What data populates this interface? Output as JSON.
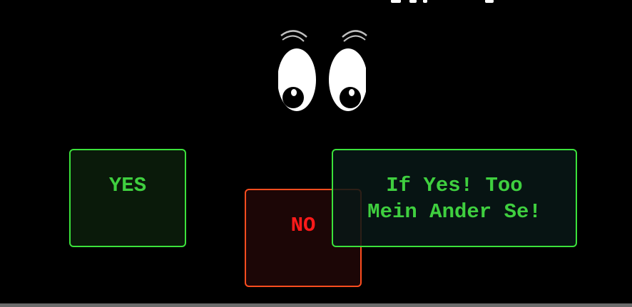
{
  "colors": {
    "background": "#000000",
    "yes_green": "#3fcf3f",
    "yes_border": "#3be13b",
    "no_red": "#ff1a1a",
    "no_border": "#ff4d1f"
  },
  "decorations": {
    "eyes_icon": "cartoon-eyes-icon"
  },
  "buttons": {
    "yes_label": "YES",
    "no_label": "NO",
    "conditional_label": "If Yes! Too\nMein Ander Se!"
  }
}
